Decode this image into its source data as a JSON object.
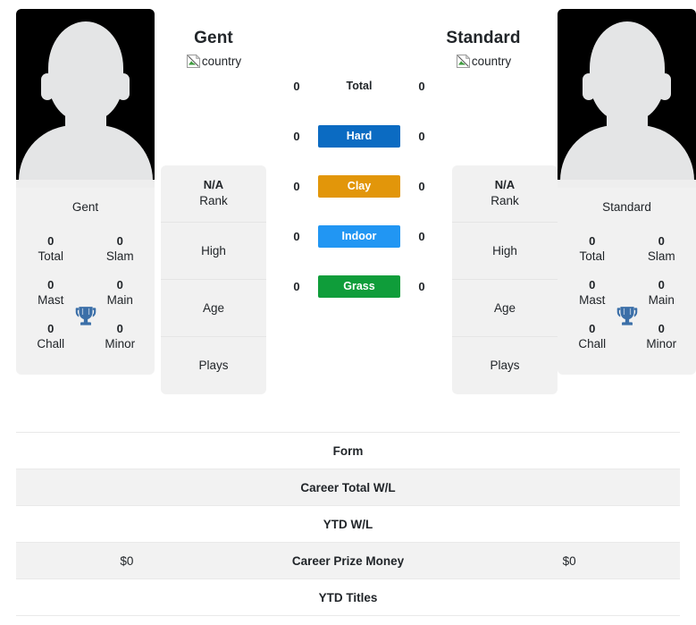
{
  "players": {
    "left": {
      "heading": "Gent",
      "country_alt": "country",
      "card_name": "Gent",
      "avatar_alt": "Gent",
      "titles": [
        {
          "value": "0",
          "label": "Total"
        },
        {
          "value": "0",
          "label": "Slam"
        },
        {
          "value": "0",
          "label": "Mast"
        },
        {
          "value": "0",
          "label": "Main"
        },
        {
          "value": "0",
          "label": "Chall"
        },
        {
          "value": "0",
          "label": "Minor"
        }
      ],
      "info": [
        {
          "top": "N/A",
          "bottom": "Rank"
        },
        {
          "top": "",
          "bottom": "High"
        },
        {
          "top": "",
          "bottom": "Age"
        },
        {
          "top": "",
          "bottom": "Plays"
        }
      ]
    },
    "right": {
      "heading": "Standard",
      "country_alt": "country",
      "card_name": "Standard",
      "avatar_alt": "Standard",
      "titles": [
        {
          "value": "0",
          "label": "Total"
        },
        {
          "value": "0",
          "label": "Slam"
        },
        {
          "value": "0",
          "label": "Mast"
        },
        {
          "value": "0",
          "label": "Main"
        },
        {
          "value": "0",
          "label": "Chall"
        },
        {
          "value": "0",
          "label": "Minor"
        }
      ],
      "info": [
        {
          "top": "N/A",
          "bottom": "Rank"
        },
        {
          "top": "",
          "bottom": "High"
        },
        {
          "top": "",
          "bottom": "Age"
        },
        {
          "top": "",
          "bottom": "Plays"
        }
      ]
    }
  },
  "surfaces": [
    {
      "label": "Total",
      "left": "0",
      "right": "0",
      "badge": false,
      "color": ""
    },
    {
      "label": "Hard",
      "left": "0",
      "right": "0",
      "badge": true,
      "color": "#0b6bc2"
    },
    {
      "label": "Clay",
      "left": "0",
      "right": "0",
      "badge": true,
      "color": "#e2960a"
    },
    {
      "label": "Indoor",
      "left": "0",
      "right": "0",
      "badge": true,
      "color": "#2196f3"
    },
    {
      "label": "Grass",
      "left": "0",
      "right": "0",
      "badge": true,
      "color": "#0f9d3a"
    }
  ],
  "comparison_rows": [
    {
      "left": "",
      "label": "Form",
      "right": "",
      "striped": false
    },
    {
      "left": "",
      "label": "Career Total W/L",
      "right": "",
      "striped": true
    },
    {
      "left": "",
      "label": "YTD W/L",
      "right": "",
      "striped": false
    },
    {
      "left": "$0",
      "label": "Career Prize Money",
      "right": "$0",
      "striped": true
    },
    {
      "left": "",
      "label": "YTD Titles",
      "right": "",
      "striped": false
    }
  ],
  "icons": {
    "trophy": "trophy-icon",
    "broken_image": "broken-image-icon"
  }
}
